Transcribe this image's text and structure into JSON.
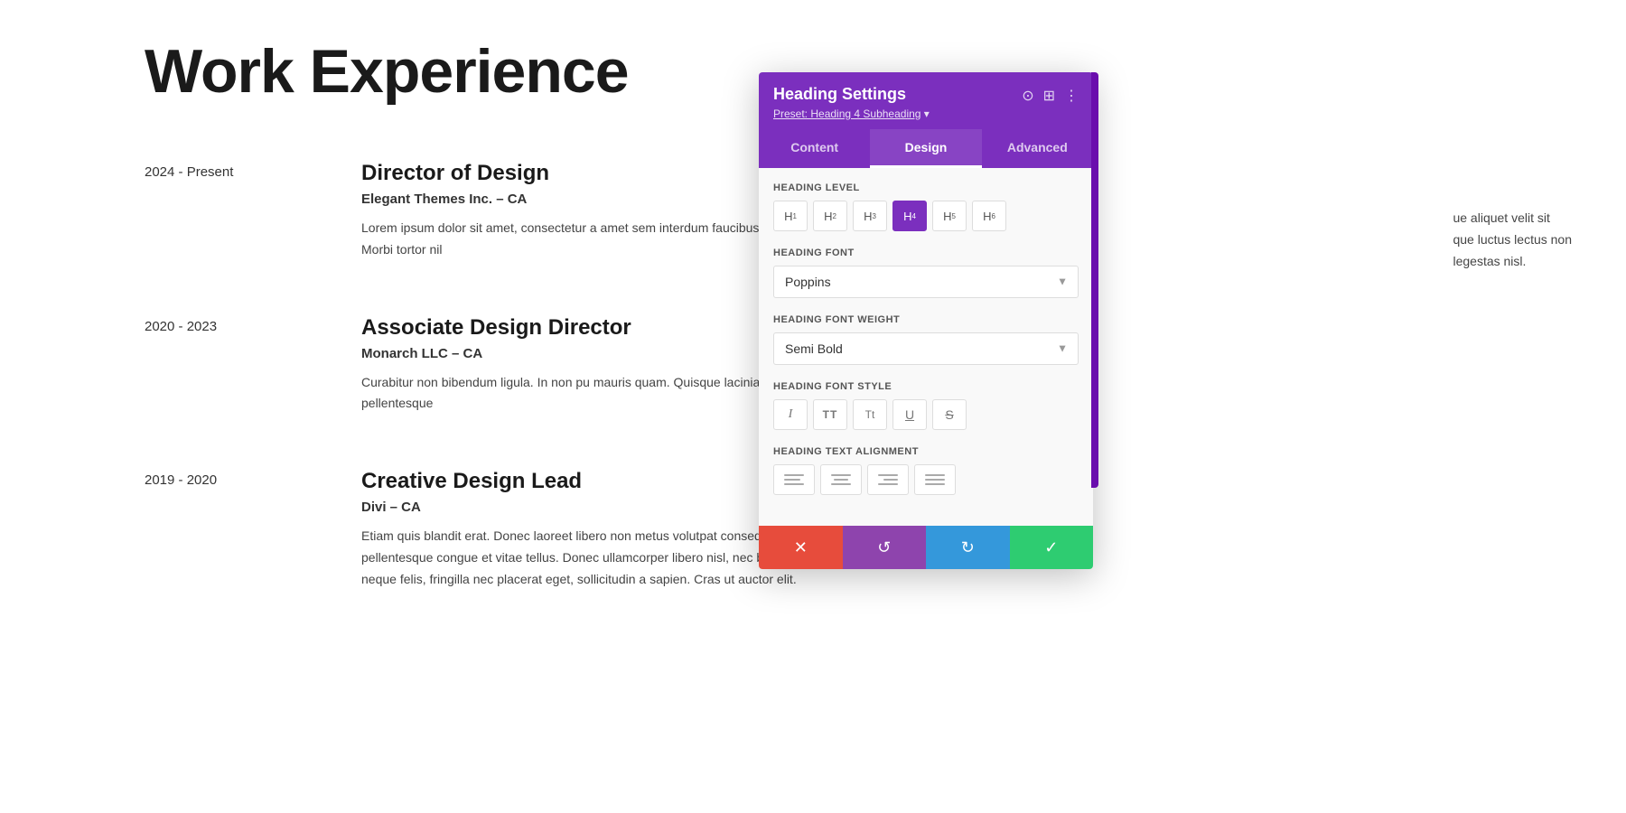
{
  "page": {
    "title": "Work Experience",
    "right_text_lines": [
      "ue aliquet velit sit",
      "que luctus lectus non",
      "legestas nisl."
    ]
  },
  "jobs": [
    {
      "date": "2024 - Present",
      "title": "Director of Design",
      "company": "Elegant Themes Inc. – CA",
      "description": "Lorem ipsum dolor sit amet, consectetur a amet sem interdum faucibus. In feugiat al turpis bibendum posuere. Morbi tortor nil"
    },
    {
      "date": "2020 - 2023",
      "title": "Associate Design Director",
      "company": "Monarch LLC – CA",
      "description": "Curabitur non bibendum ligula. In non pu mauris quam. Quisque lacinia quam eu co orci. Sed vitae nulla et justo pellentesque"
    },
    {
      "date": "2019 - 2020",
      "title": "Creative Design Lead",
      "company": "Divi – CA",
      "description": "Etiam quis blandit erat. Donec laoreet libero non metus volutpat consequat in vel metus. Sed non augue id felis pellentesque congue et vitae tellus. Donec ullamcorper libero nisl, nec blandit dolor tempus feugiat. Aenean neque felis, fringilla nec placerat eget, sollicitudin a sapien. Cras ut auctor elit."
    }
  ],
  "panel": {
    "title": "Heading Settings",
    "preset_label": "Preset: Heading 4 Subheading",
    "tabs": [
      {
        "id": "content",
        "label": "Content",
        "active": false
      },
      {
        "id": "design",
        "label": "Design",
        "active": true
      },
      {
        "id": "advanced",
        "label": "Advanced",
        "active": false
      }
    ],
    "heading_level_label": "Heading Level",
    "heading_levels": [
      "H1",
      "H2",
      "H3",
      "H4",
      "H5",
      "H6"
    ],
    "active_heading": "H4",
    "font_label": "Heading Font",
    "font_value": "Poppins",
    "font_weight_label": "Heading Font Weight",
    "font_weight_value": "Semi Bold",
    "font_style_label": "Heading Font Style",
    "font_styles": [
      "I",
      "TT",
      "Tt",
      "U",
      "S"
    ],
    "text_alignment_label": "Heading Text Alignment",
    "footer_buttons": [
      {
        "id": "cancel",
        "label": "✕",
        "color": "#e74c3c"
      },
      {
        "id": "undo",
        "label": "↺",
        "color": "#8e44ad"
      },
      {
        "id": "redo",
        "label": "↻",
        "color": "#3498db"
      },
      {
        "id": "confirm",
        "label": "✓",
        "color": "#2ecc71"
      }
    ]
  }
}
